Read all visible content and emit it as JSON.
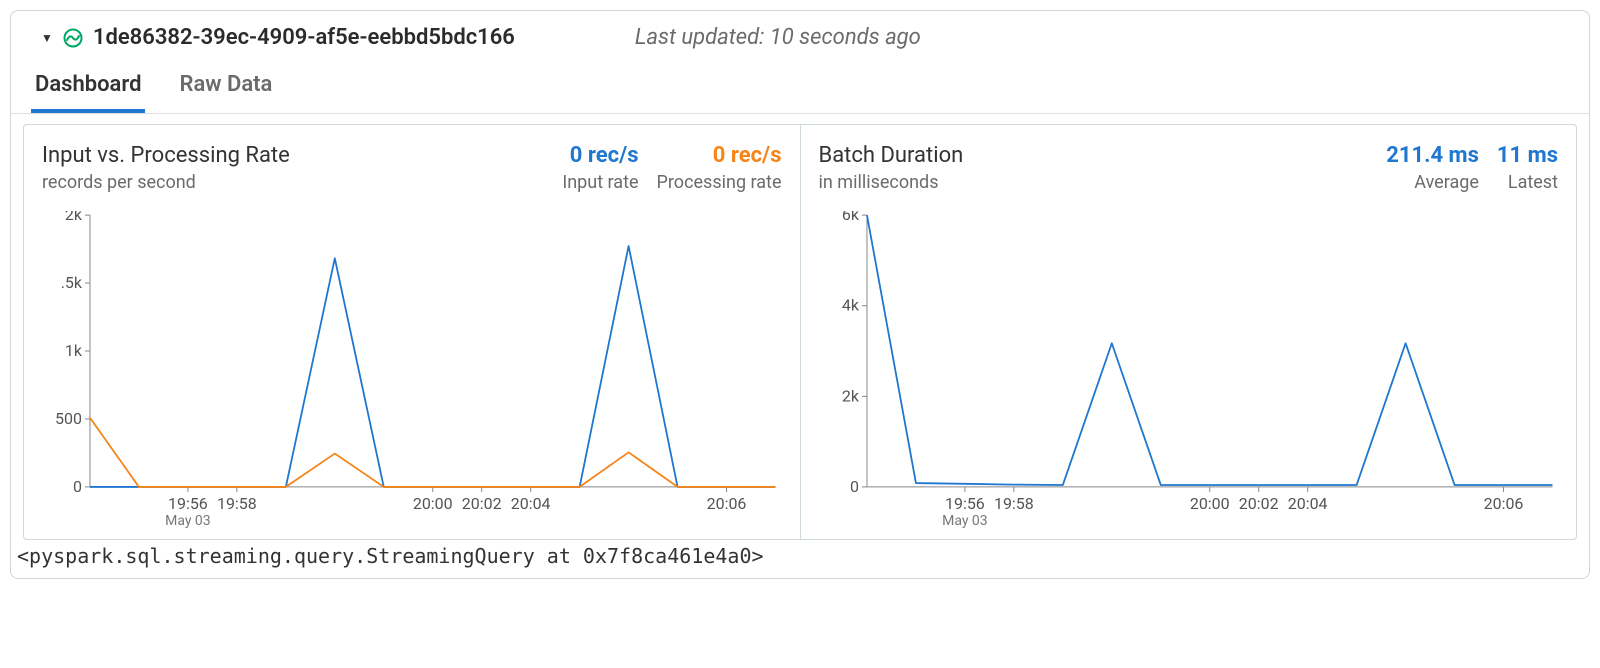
{
  "header": {
    "stream_id": "1de86382-39ec-4909-af5e-eebbd5bdc166",
    "last_updated": "Last updated: 10 seconds ago"
  },
  "tabs": {
    "dashboard": "Dashboard",
    "raw_data": "Raw Data"
  },
  "left_panel": {
    "title": "Input vs. Processing Rate",
    "subtitle": "records per second",
    "metric_input_value": "0 rec/s",
    "metric_input_label": "Input rate",
    "metric_proc_value": "0 rec/s",
    "metric_proc_label": "Processing rate"
  },
  "right_panel": {
    "title": "Batch Duration",
    "subtitle": "in milliseconds",
    "metric_avg_value": "211.4 ms",
    "metric_avg_label": "Average",
    "metric_latest_value": "11 ms",
    "metric_latest_label": "Latest"
  },
  "repr": "<pyspark.sql.streaming.query.StreamingQuery at 0x7f8ca461e4a0>",
  "chart_data": [
    {
      "type": "line",
      "title": "Input vs. Processing Rate",
      "xlabel": "",
      "ylabel": "records per second",
      "ylim": [
        0,
        2200
      ],
      "x": [
        "19:55.0",
        "19:55.3",
        "19:56",
        "19:58",
        "19:59.7",
        "19:59.8",
        "19:59.9",
        "20:00.2",
        "20:02",
        "20:04",
        "20:05.6",
        "20:05.7",
        "20:05.8",
        "20:06.1",
        "20:06.5"
      ],
      "x_ticks": [
        "19:56",
        "19:58",
        "20:00",
        "20:02",
        "20:04",
        "20:06"
      ],
      "x_month": "May 03",
      "y_ticks": [
        "0",
        "500",
        "1k",
        ".5k",
        "2k"
      ],
      "series": [
        {
          "name": "Input rate",
          "color": "#1f77d0",
          "values": [
            0,
            0,
            0,
            0,
            0,
            1850,
            0,
            0,
            0,
            0,
            0,
            1950,
            0,
            0,
            0
          ]
        },
        {
          "name": "Processing rate",
          "color": "#f58518",
          "values": [
            560,
            0,
            0,
            0,
            0,
            270,
            0,
            0,
            0,
            0,
            0,
            280,
            0,
            0,
            0
          ]
        }
      ]
    },
    {
      "type": "line",
      "title": "Batch Duration",
      "xlabel": "",
      "ylabel": "in milliseconds",
      "ylim": [
        0,
        7000
      ],
      "x": [
        "19:55.0",
        "19:55.3",
        "19:56",
        "19:58",
        "19:59.7",
        "19:59.8",
        "19:59.9",
        "20:00.2",
        "20:02",
        "20:04",
        "20:05.6",
        "20:05.7",
        "20:05.8",
        "20:06.1",
        "20:06.5"
      ],
      "x_ticks": [
        "19:56",
        "19:58",
        "20:00",
        "20:02",
        "20:04",
        "20:06"
      ],
      "x_month": "May 03",
      "y_ticks": [
        "0",
        "2k",
        "4k",
        "6k"
      ],
      "series": [
        {
          "name": "Batch Duration",
          "color": "#1f77d0",
          "values": [
            7000,
            100,
            80,
            60,
            50,
            3700,
            50,
            50,
            50,
            50,
            50,
            3700,
            50,
            50,
            50
          ]
        }
      ]
    }
  ]
}
